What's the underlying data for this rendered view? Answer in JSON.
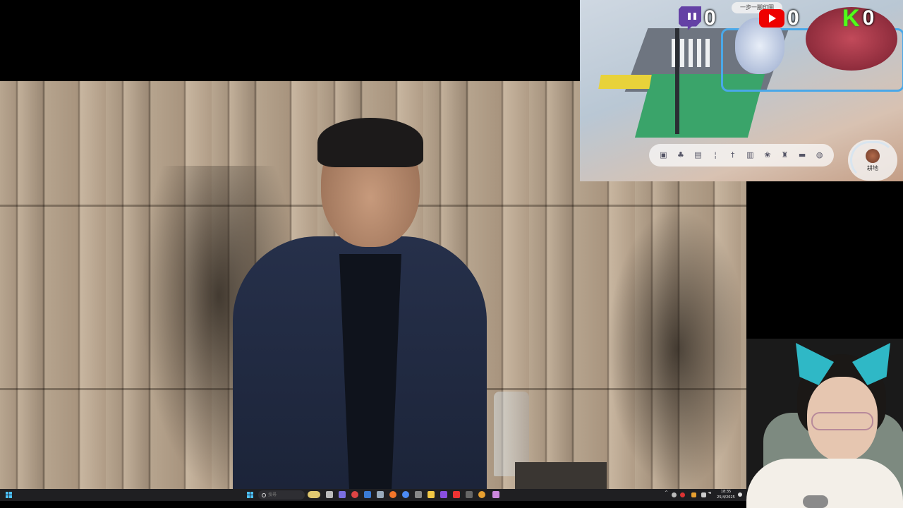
{
  "scoreboard": {
    "twitch": {
      "icon": "twitch-icon",
      "count": "0",
      "color": "#6441a5"
    },
    "youtube": {
      "icon": "youtube-icon",
      "count": "0",
      "color": "#ff0000"
    },
    "kick": {
      "icon": "kick-icon",
      "count": "0",
      "label": "K",
      "color": "#53fc18"
    }
  },
  "game": {
    "tip_text": "一步一腳印圖",
    "tool_label": "耕地",
    "hotbar_items": [
      "chest-icon",
      "bush-icon",
      "fence-icon",
      "torch-icon",
      "lamp-icon",
      "cabinet-icon",
      "plant-icon",
      "trophy-icon",
      "brick-icon",
      "bucket-icon"
    ],
    "hotbar_glyphs": [
      "▣",
      "♣",
      "▤",
      "¦",
      "†",
      "▥",
      "❀",
      "♜",
      "▬",
      "◍"
    ]
  },
  "taskbar": {
    "search_placeholder": "搜尋",
    "clock_time": "18:35",
    "clock_date": "25/4/2025",
    "start_color": "#4cc2ff"
  }
}
